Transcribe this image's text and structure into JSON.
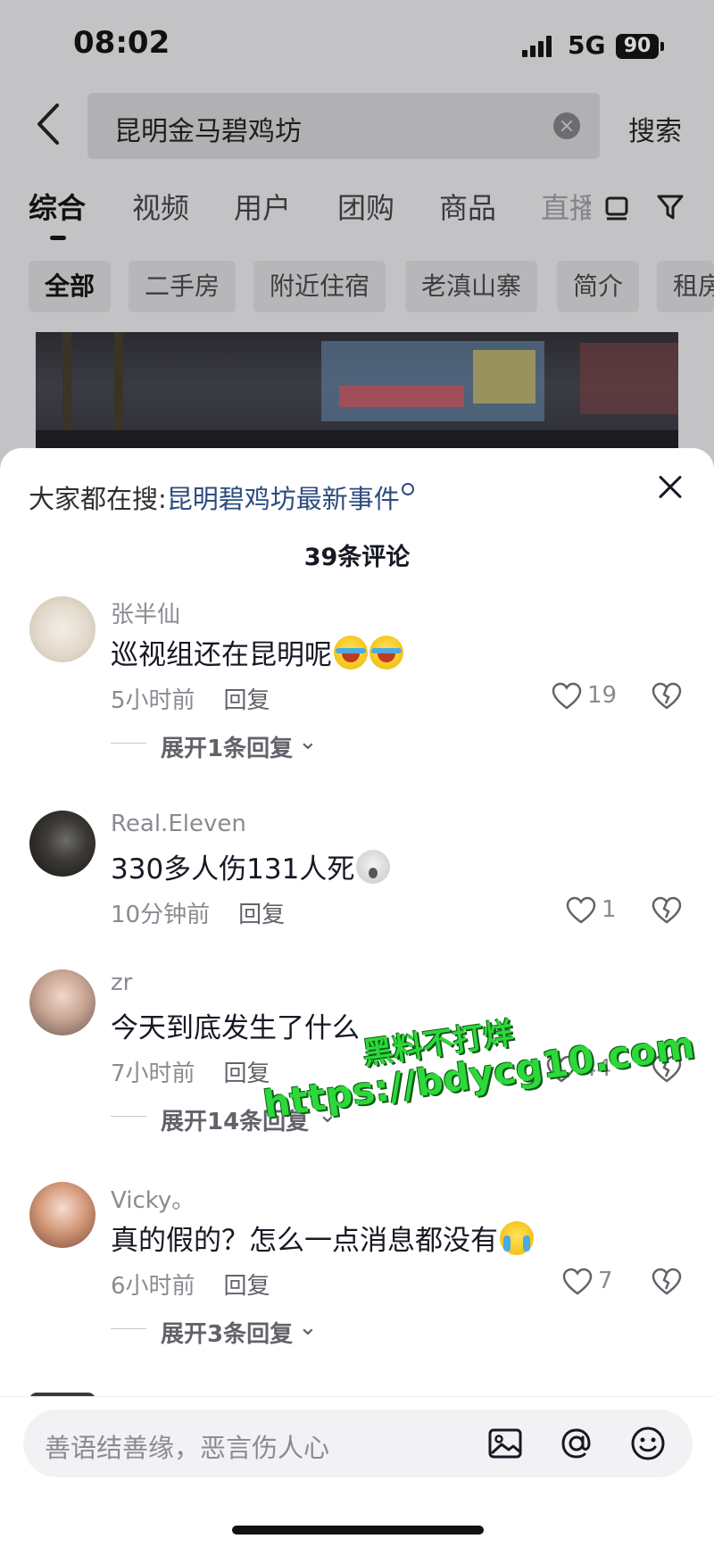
{
  "status_bar": {
    "time": "08:02",
    "network": "5G",
    "battery": "90"
  },
  "search": {
    "query": "昆明金马碧鸡坊",
    "button_label": "搜索"
  },
  "tabs": [
    {
      "label": "综合",
      "active": true
    },
    {
      "label": "视频"
    },
    {
      "label": "用户"
    },
    {
      "label": "团购"
    },
    {
      "label": "商品"
    },
    {
      "label": "直播"
    }
  ],
  "chips": [
    {
      "label": "全部",
      "active": true
    },
    {
      "label": "二手房"
    },
    {
      "label": "附近住宿"
    },
    {
      "label": "老滇山寨"
    },
    {
      "label": "简介"
    },
    {
      "label": "租房"
    }
  ],
  "comment_sheet": {
    "hot_search_prefix": "大家都在搜:",
    "hot_search_link": "昆明碧鸡坊最新事件",
    "count_label": "39条评论",
    "reply_label": "回复"
  },
  "comments": [
    {
      "username": "张半仙",
      "text": "巡视组还在昆明呢",
      "emoji": [
        "laugh-cry-emoji",
        "laugh-cry-emoji"
      ],
      "time": "5小时前",
      "likes": "19",
      "expand": "展开1条回复"
    },
    {
      "username": "Real.Eleven",
      "text": "330多人伤131人死",
      "emoji": [
        "shocked-emoji"
      ],
      "time": "10分钟前",
      "likes": "1",
      "expand": ""
    },
    {
      "username": "zr",
      "text": "今天到底发生了什么",
      "emoji": [],
      "time": "7小时前",
      "likes": "44",
      "expand": "展开14条回复"
    },
    {
      "username": "Vicky。",
      "text": "真的假的？怎么一点消息都没有",
      "emoji": [
        "crying-emoji"
      ],
      "time": "6小时前",
      "likes": "7",
      "expand": "展开3条回复"
    }
  ],
  "watermark": {
    "line1": "黑料不打烊",
    "line2": "https://bdycg10.com"
  },
  "input_bar": {
    "placeholder": "善语结善缘，恶言伤人心"
  },
  "colors": {
    "link": "#2e4c7e",
    "watermark": "#2cd83a",
    "muted": "#8a8b91"
  }
}
